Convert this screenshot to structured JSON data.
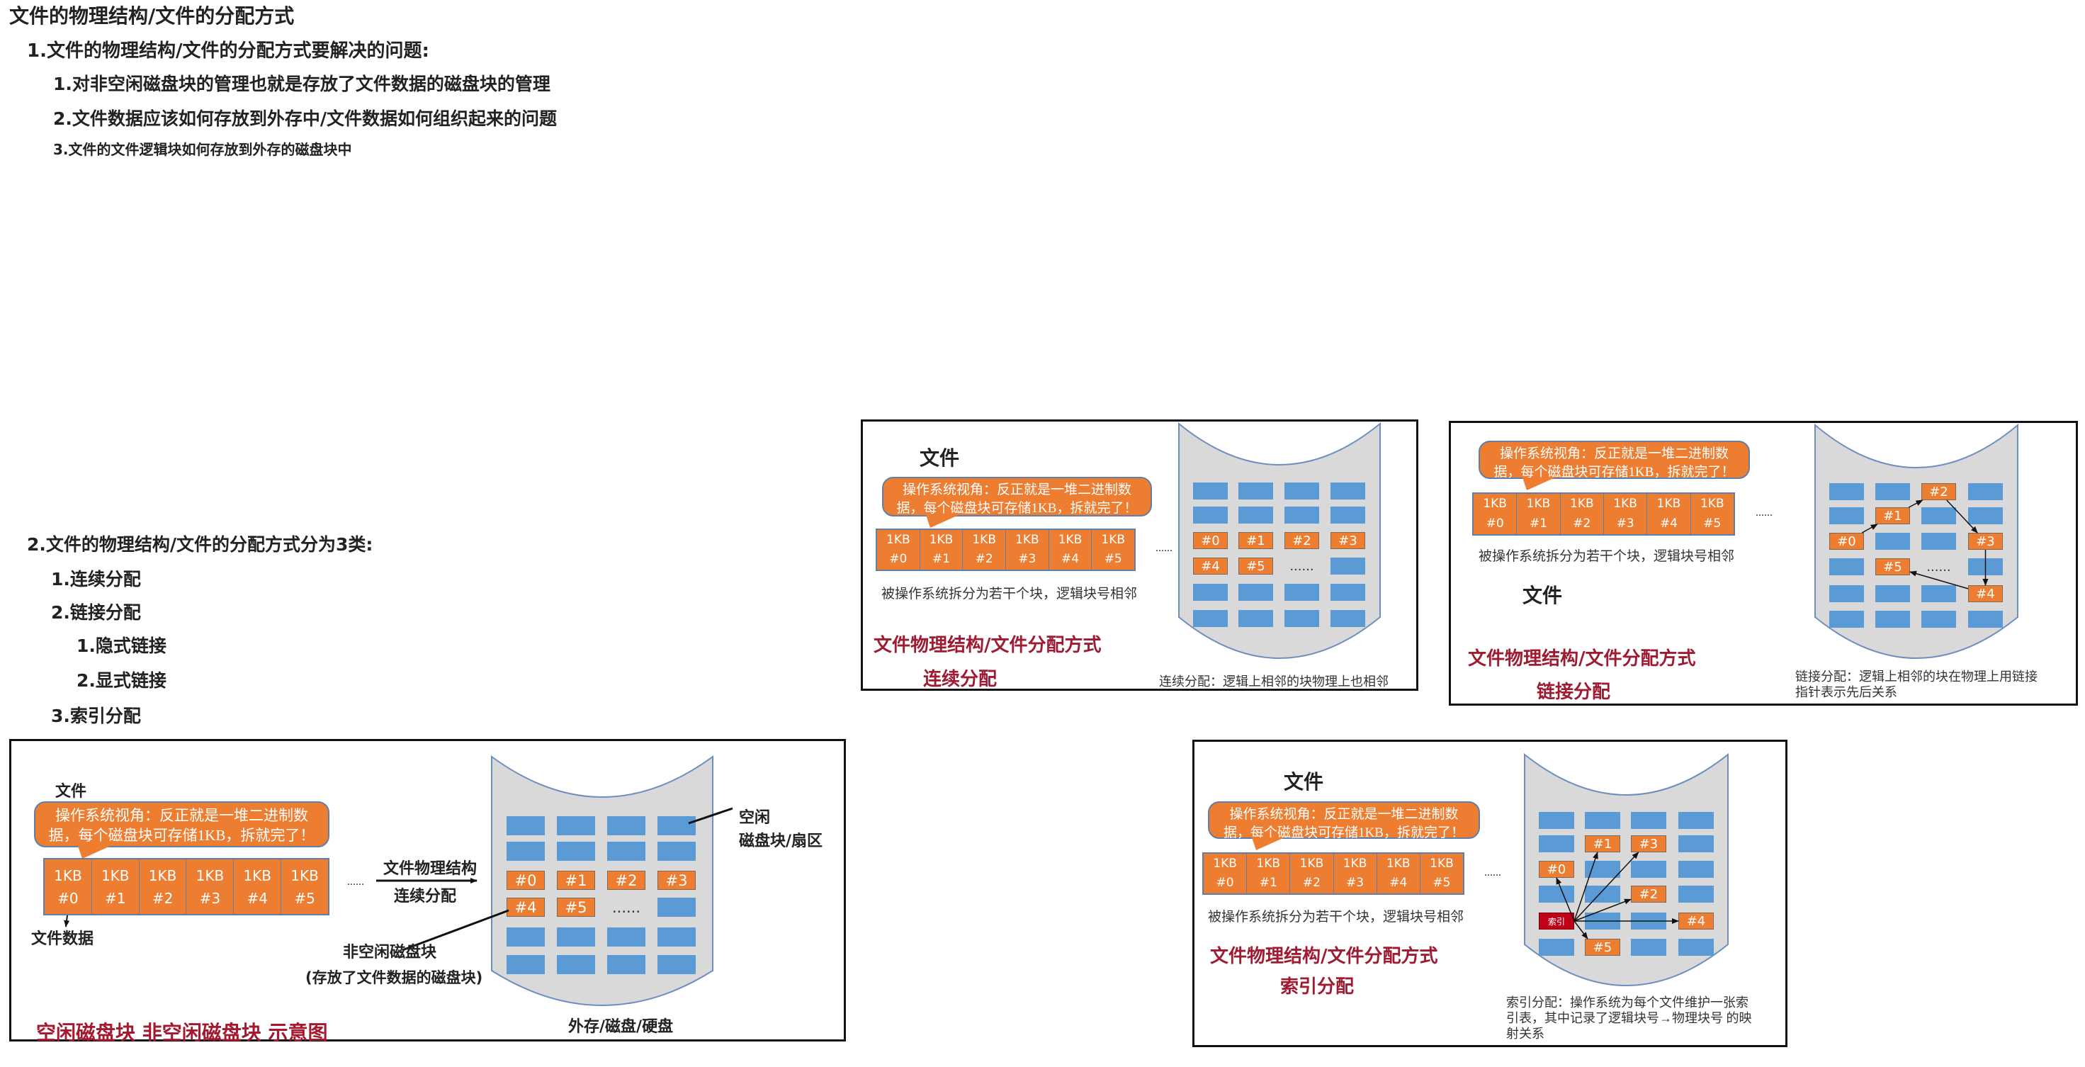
{
  "outline": [
    {
      "text": "文件的物理结构/文件的分配方式"
    },
    {
      "text": "1.文件的物理结构/文件的分配方式要解决的问题:"
    },
    {
      "text": "1.对非空闲磁盘块的管理也就是存放了文件数据的磁盘块的管理"
    },
    {
      "text": "2.文件数据应该如何存放到外存中/文件数据如何组织起来的问题"
    },
    {
      "text": "3.文件的文件逻辑块如何存放到外存的磁盘块中"
    },
    {
      "text": "2.文件的物理结构/文件的分配方式分为3类:"
    },
    {
      "text": "1.连续分配"
    },
    {
      "text": "2.链接分配"
    },
    {
      "text": "1.隐式链接"
    },
    {
      "text": "2.显式链接"
    },
    {
      "text": "3.索引分配"
    }
  ],
  "colors": {
    "orange": "#ed7d31",
    "blue": "#5b9bd5",
    "disk": "#d9d9d9",
    "index": "#c00018",
    "title_red": "#9e1b32"
  },
  "diagrams": {
    "overview": {
      "file_label": "文件",
      "bubble_text": "操作系统视角：反正就是一堆二进制数据，每个磁盘块可存储1KB，拆就完了！",
      "blocks": [
        {
          "size": "1KB",
          "id": "#0"
        },
        {
          "size": "1KB",
          "id": "#1"
        },
        {
          "size": "1KB",
          "id": "#2"
        },
        {
          "size": "1KB",
          "id": "#3"
        },
        {
          "size": "1KB",
          "id": "#4"
        },
        {
          "size": "1KB",
          "id": "#5"
        }
      ],
      "ellipsis": "......",
      "grid": [
        [
          "",
          "",
          "",
          ""
        ],
        [
          "",
          "",
          "",
          ""
        ],
        [
          "#0",
          "#1",
          "#2",
          "#3"
        ],
        [
          "#4",
          "#5",
          "......",
          ""
        ],
        [
          "",
          "",
          "",
          ""
        ],
        [
          "",
          "",
          "",
          ""
        ]
      ],
      "file_data_label": "文件数据",
      "arrow_label_top": "文件物理结构",
      "arrow_label_bottom": "连续分配",
      "free_label_1": "空闲",
      "free_label_2": "磁盘块/扇区",
      "used_label_1": "非空闲磁盘块",
      "used_label_2": "(存放了文件数据的磁盘块)",
      "disk_label": "外存/磁盘/硬盘",
      "title": "空闲磁盘块 非空闲磁盘块 示意图"
    },
    "contiguous": {
      "file_label": "文件",
      "bubble_text": "操作系统视角：反正就是一堆二进制数据，每个磁盘块可存储1KB，拆就完了！",
      "blocks": [
        {
          "size": "1KB",
          "id": "#0"
        },
        {
          "size": "1KB",
          "id": "#1"
        },
        {
          "size": "1KB",
          "id": "#2"
        },
        {
          "size": "1KB",
          "id": "#3"
        },
        {
          "size": "1KB",
          "id": "#4"
        },
        {
          "size": "1KB",
          "id": "#5"
        }
      ],
      "ellipsis": "......",
      "caption": "被操作系统拆分为若干个块，逻辑块号相邻",
      "grid": [
        [
          "",
          "",
          "",
          ""
        ],
        [
          "",
          "",
          "",
          ""
        ],
        [
          "#0",
          "#1",
          "#2",
          "#3"
        ],
        [
          "#4",
          "#5",
          "......",
          ""
        ],
        [
          "",
          "",
          "",
          ""
        ],
        [
          "",
          "",
          "",
          ""
        ]
      ],
      "title": "文件物理结构/文件分配方式",
      "subtitle": "连续分配",
      "footnote": [
        "连续分配：逻辑上相邻的块物理上也相邻"
      ],
      "links": []
    },
    "linked": {
      "file_label": "文件",
      "bubble_text": "操作系统视角：反正就是一堆二进制数据，每个磁盘块可存储1KB，拆就完了！",
      "blocks": [
        {
          "size": "1KB",
          "id": "#0"
        },
        {
          "size": "1KB",
          "id": "#1"
        },
        {
          "size": "1KB",
          "id": "#2"
        },
        {
          "size": "1KB",
          "id": "#3"
        },
        {
          "size": "1KB",
          "id": "#4"
        },
        {
          "size": "1KB",
          "id": "#5"
        }
      ],
      "ellipsis": "......",
      "caption": "被操作系统拆分为若干个块，逻辑块号相邻",
      "grid": [
        [
          "",
          "",
          "#2",
          ""
        ],
        [
          "",
          "#1",
          "",
          ""
        ],
        [
          "#0",
          "",
          "",
          "#3"
        ],
        [
          "",
          "#5",
          "......",
          ""
        ],
        [
          "",
          "",
          "",
          "#4"
        ],
        [
          "",
          "",
          "",
          ""
        ]
      ],
      "title": "文件物理结构/文件分配方式",
      "subtitle": "链接分配",
      "footnote": [
        "链接分配：逻辑上相邻的块在物理上用链接",
        "指针表示先后关系"
      ],
      "links": [
        [
          "#0",
          "#1"
        ],
        [
          "#1",
          "#2"
        ],
        [
          "#2",
          "#3"
        ],
        [
          "#3",
          "#4"
        ],
        [
          "#4",
          "#5"
        ]
      ]
    },
    "indexed": {
      "file_label": "文件",
      "bubble_text": "操作系统视角：反正就是一堆二进制数据，每个磁盘块可存储1KB，拆就完了！",
      "blocks": [
        {
          "size": "1KB",
          "id": "#0"
        },
        {
          "size": "1KB",
          "id": "#1"
        },
        {
          "size": "1KB",
          "id": "#2"
        },
        {
          "size": "1KB",
          "id": "#3"
        },
        {
          "size": "1KB",
          "id": "#4"
        },
        {
          "size": "1KB",
          "id": "#5"
        }
      ],
      "ellipsis": "......",
      "caption": "被操作系统拆分为若干个块，逻辑块号相邻",
      "grid": [
        [
          "",
          "",
          "",
          ""
        ],
        [
          "",
          "#1",
          "#3",
          ""
        ],
        [
          "#0",
          "",
          "",
          ""
        ],
        [
          "",
          "",
          "#2",
          ""
        ],
        [
          "索引",
          "",
          "",
          "#4"
        ],
        [
          "",
          "#5",
          "",
          ""
        ]
      ],
      "title": "文件物理结构/文件分配方式",
      "subtitle": "索引分配",
      "footnote": [
        "索引分配：操作系统为每个文件维护一张索",
        "引表，其中记录了逻辑块号→物理块号 的映",
        "射关系"
      ],
      "links": [
        [
          "索引",
          "#0"
        ],
        [
          "索引",
          "#1"
        ],
        [
          "索引",
          "#2"
        ],
        [
          "索引",
          "#3"
        ],
        [
          "索引",
          "#4"
        ],
        [
          "索引",
          "#5"
        ]
      ]
    }
  }
}
